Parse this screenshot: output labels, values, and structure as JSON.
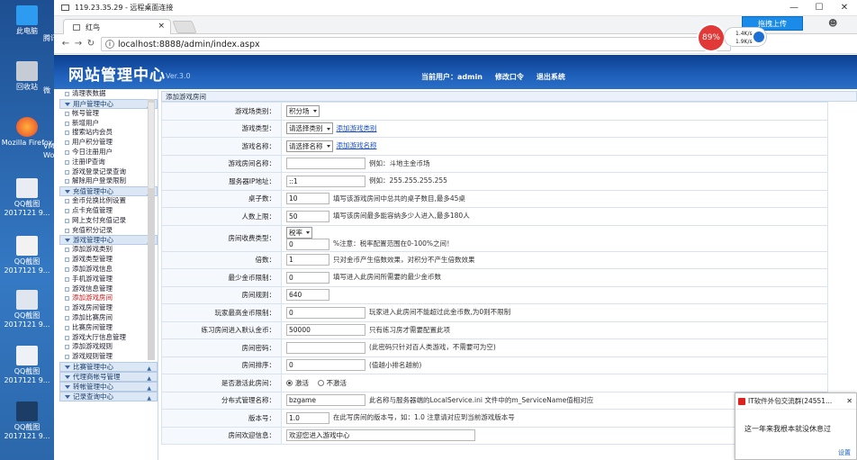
{
  "desktop": {
    "icons": [
      {
        "label": "此电脑"
      },
      {
        "label": "回收站"
      },
      {
        "label": "Mozilla Firefox"
      },
      {
        "label": "QQ截图 2017121 9..."
      },
      {
        "label": "QQ截图 2017121 9..."
      },
      {
        "label": "QQ截图 2017121 9..."
      },
      {
        "label": "QQ截图 2017121 9..."
      },
      {
        "label": "QQ截图 2017121 9..."
      }
    ],
    "peek": [
      {
        "label": "腾讯"
      },
      {
        "label": "微"
      },
      {
        "label": "VM Work"
      }
    ]
  },
  "rdp": {
    "title": "119.23.35.29 - 远程桌面连接",
    "win_min": "—",
    "win_max": "☐",
    "win_close": "✕"
  },
  "browser": {
    "tab_title": "红鸟",
    "tab_close": "×",
    "url": "localhost:8888/admin/index.aspx",
    "upload_btn": "拖拽上传",
    "mem_percent": "89%",
    "speed_up": "1.4K/s",
    "speed_down": "1.9K/s"
  },
  "header": {
    "logo": "网站管理中心",
    "version": "Ver.3.0",
    "current_user": "当前用户：admin",
    "change_pwd": "修改口令",
    "logout": "退出系统"
  },
  "sidebar": {
    "top_item": "清理表数据",
    "sections": [
      {
        "title": "用户管理中心",
        "items": [
          "帐号管理",
          "新增用户",
          "搜索站内会员",
          "用户积分管理",
          "今日注册用户",
          "注册IP查询",
          "游戏登录记录查询",
          "解除用户登录限制"
        ]
      },
      {
        "title": "充值管理中心",
        "items": [
          "金币兑换比例设置",
          "点卡充值管理",
          "网上支付充值记录",
          "充值积分记录"
        ]
      },
      {
        "title": "游戏管理中心",
        "items": [
          "添加游戏类别",
          "游戏类型管理",
          "添加游戏信息",
          "手机游戏管理",
          "游戏信息管理",
          "添加游戏房间",
          "游戏房间管理",
          "添加比赛房间",
          "比赛房间管理",
          "游戏大厅信息管理",
          "添加游戏规则",
          "游戏规则管理"
        ]
      },
      {
        "title": "比赛管理中心",
        "items": []
      },
      {
        "title": "代理商帐号管理",
        "items": []
      },
      {
        "title": "转帐管理中心",
        "items": []
      },
      {
        "title": "记录查询中心",
        "items": []
      }
    ],
    "active_item": "添加游戏房间"
  },
  "main": {
    "title": "添加游戏房间",
    "rows": [
      {
        "label": "游戏场类别：",
        "select": "积分场"
      },
      {
        "label": "游戏类型：",
        "select": "请选择类别",
        "link": "添加游戏类别"
      },
      {
        "label": "游戏名称：",
        "select": "请选择名称",
        "link": "添加游戏名称"
      },
      {
        "label": "游戏房间名称：",
        "input": "",
        "hint": "例如：斗地主金币场"
      },
      {
        "label": "服务器IP地址：",
        "input": "::1",
        "hint": "例如：255.255.255.255"
      },
      {
        "label": "桌子数：",
        "input": "10",
        "hint": "填写该游戏房间中总共的桌子数目,最多45桌"
      },
      {
        "label": "人数上限：",
        "input": "50",
        "hint": "填写该房间最多能容纳多少人进入,最多180人"
      },
      {
        "label": "房间收费类型：",
        "select": "税率",
        "input": "0",
        "hint": "%注意：税率配置范围在0-100%之间！"
      },
      {
        "label": "倍数：",
        "input": "1",
        "hint": "只对金币产生倍数效果，对积分不产生倍数效果"
      },
      {
        "label": "最少金币限制：",
        "input": "0",
        "hint": "填写进入此房间所需要的最少金币数"
      },
      {
        "label": "房间规则：",
        "input": "640",
        "hint": ""
      },
      {
        "label": "玩家最高金币限制：",
        "input": "0",
        "hint": "玩家进入此房间不能超过此金币数,为0则不限制"
      },
      {
        "label": "练习房间进入默认金币：",
        "input": "50000",
        "hint": "只有练习房才需要配置此项"
      },
      {
        "label": "房间密码：",
        "input": "",
        "hint": "(此密码只针对百人类游戏，不需要可为空)"
      },
      {
        "label": "房间排序：",
        "input": "0",
        "hint": "(值越小排名越前)"
      },
      {
        "label": "是否激活此房间：",
        "radio_on": "激活",
        "radio_off": "不激活"
      },
      {
        "label": "分布式管理名称：",
        "input": "bzgame",
        "hint": "此名称与服务器端的LocalService.ini 文件中的m_ServiceName值相对应"
      },
      {
        "label": "版本号：",
        "input": "1.0",
        "hint": "在此写房间的版本号，如：1.0 注意请对应到当前游戏版本号"
      },
      {
        "label": "房间欢迎信息：",
        "input": "欢迎您进入游戏中心",
        "hint": ""
      }
    ]
  },
  "popup": {
    "title": "IT软件外包交流群(24551...",
    "close": "✕",
    "message": "这一年来我根本就没休息过",
    "settings": "设置"
  },
  "colors": {
    "header_dark": "#0c3f8f",
    "header_light": "#2a6ec6",
    "sidebar_section": "#dbe7f4",
    "active_item": "#d01515",
    "link": "#1a4fc4"
  }
}
